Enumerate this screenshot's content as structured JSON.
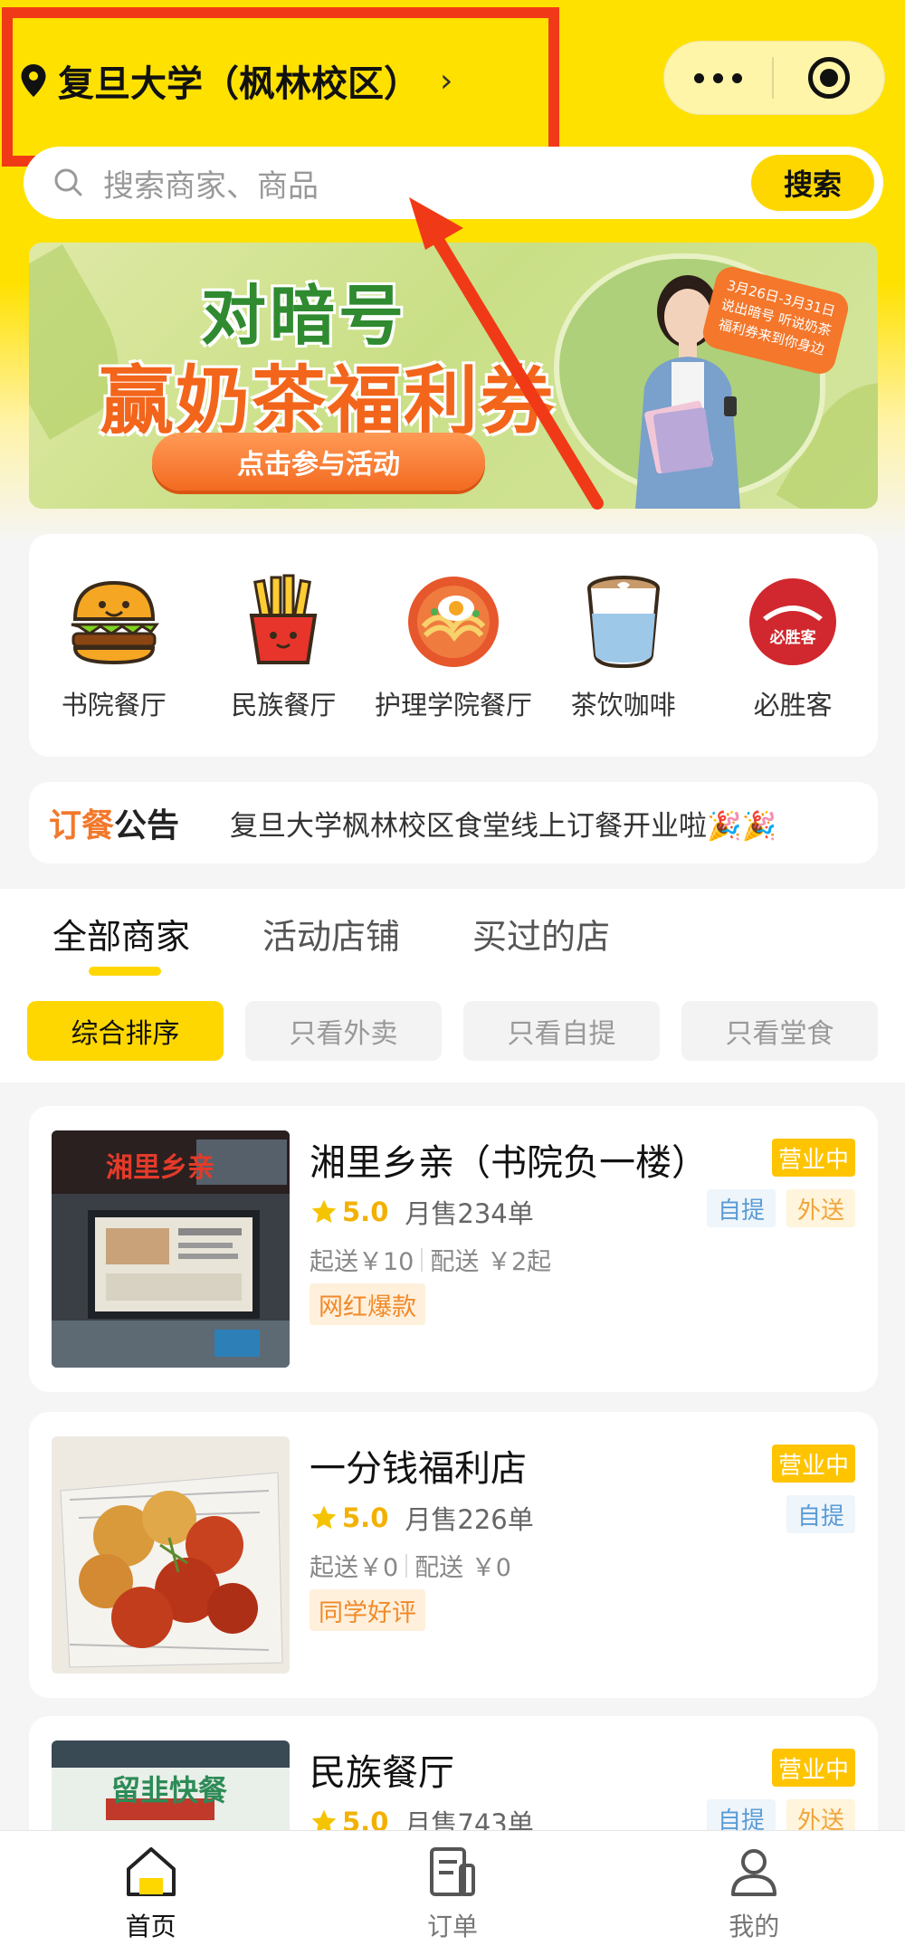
{
  "header": {
    "location": "复旦大学（枫林校区）",
    "chevron": "›"
  },
  "search": {
    "placeholder": "搜索商家、商品",
    "button": "搜索"
  },
  "banner": {
    "line1": "对暗号",
    "line2": "赢奶茶福利券",
    "cta": "点击参与活动",
    "badge": "3月26日-3月31日 说出暗号 听说奶茶福利券来到你身边"
  },
  "categories": [
    {
      "label": "书院餐厅",
      "icon": "burger-icon"
    },
    {
      "label": "民族餐厅",
      "icon": "fries-icon"
    },
    {
      "label": "护理学院餐厅",
      "icon": "noodle-bowl-icon"
    },
    {
      "label": "茶饮咖啡",
      "icon": "coffee-cup-icon"
    },
    {
      "label": "必胜客",
      "icon": "pizza-hut-logo",
      "logo_text": "必胜客"
    }
  ],
  "notice": {
    "tag_a": "订餐",
    "tag_b": "公告",
    "message": "复旦大学枫林校区食堂线上订餐开业啦🎉🎉"
  },
  "tabs": [
    "全部商家",
    "活动店铺",
    "买过的店"
  ],
  "filters": [
    "综合排序",
    "只看外卖",
    "只看自提",
    "只看堂食"
  ],
  "shops": [
    {
      "name": "湘里乡亲（书院负一楼）",
      "rating": "5.0",
      "sales": "月售234单",
      "min_order": "起送￥10",
      "delivery": "配送 ￥2起",
      "tag": "网红爆款",
      "status": "营业中",
      "pickup": "自提",
      "delivery_badge": "外送",
      "sign_text": "湘里乡亲"
    },
    {
      "name": "一分钱福利店",
      "rating": "5.0",
      "sales": "月售226单",
      "min_order": "起送￥0",
      "delivery": "配送 ￥0",
      "tag": "同学好评",
      "status": "营业中",
      "pickup": "自提"
    },
    {
      "name": "民族餐厅",
      "rating": "5.0",
      "sales": "月售743单",
      "status": "营业中",
      "pickup": "自提",
      "delivery_badge": "外送",
      "sign_text": "留韭快餐"
    }
  ],
  "tabbar": [
    {
      "label": "首页",
      "icon": "home-icon"
    },
    {
      "label": "订单",
      "icon": "order-icon"
    },
    {
      "label": "我的",
      "icon": "profile-icon"
    }
  ],
  "colors": {
    "brand_yellow": "#ffd700",
    "highlight_red": "#f03a17",
    "orange": "#f2782b"
  }
}
